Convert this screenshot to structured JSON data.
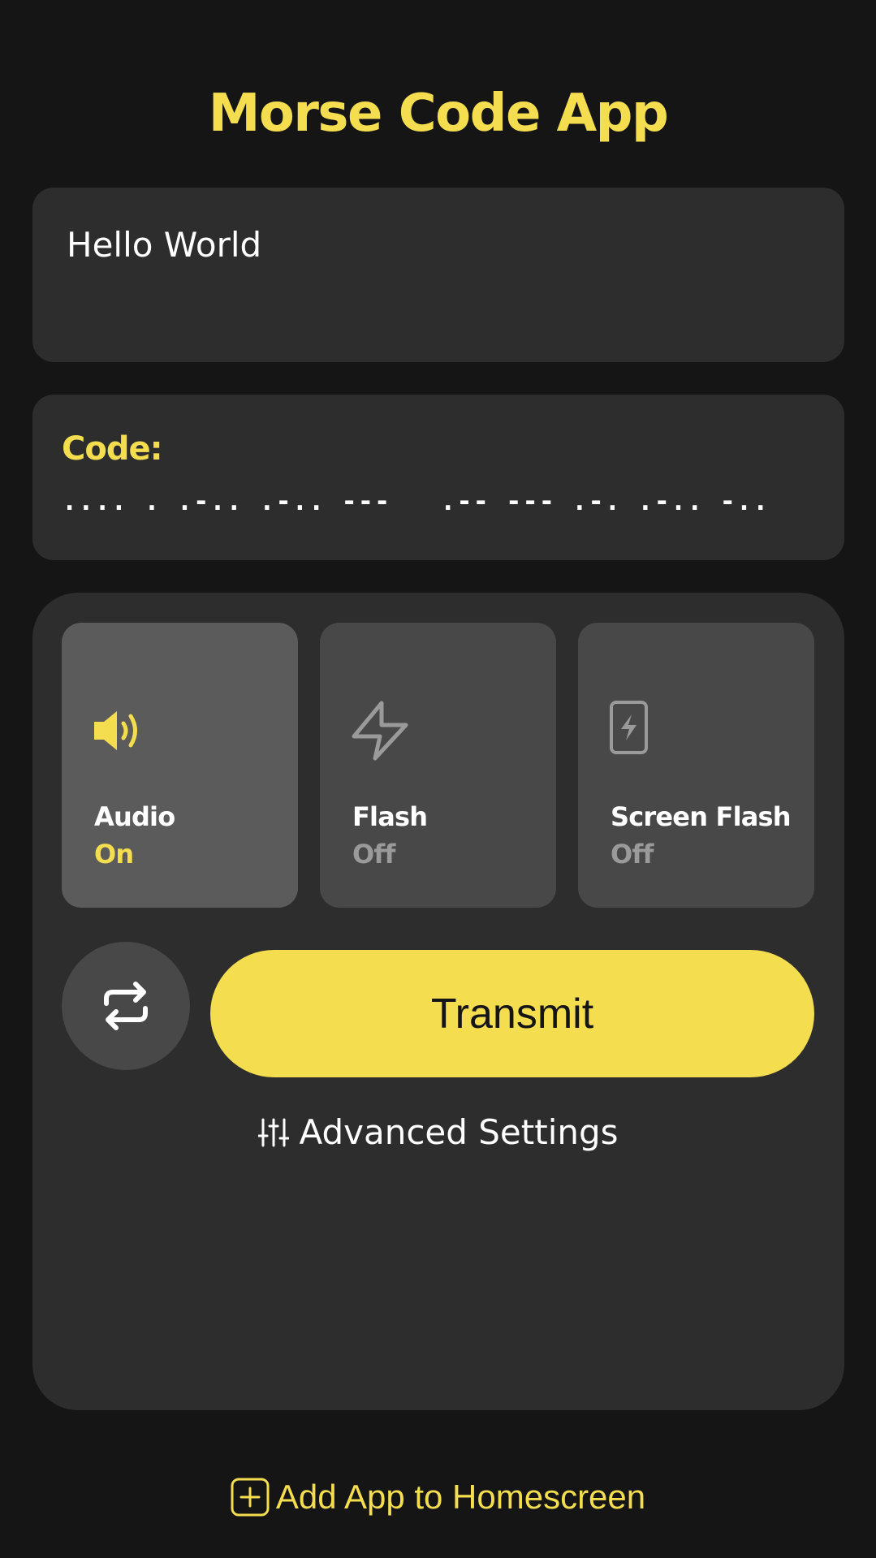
{
  "app": {
    "title": "Morse Code App"
  },
  "input": {
    "value": "Hello World"
  },
  "code": {
    "label": "Code:",
    "value": ".... . .-.. .-.. ---   .-- --- .-. .-.. -.."
  },
  "modes": [
    {
      "label": "Audio",
      "state": "On",
      "icon": "speaker-icon",
      "active": true
    },
    {
      "label": "Flash",
      "state": "Off",
      "icon": "lightning-icon",
      "active": false
    },
    {
      "label": "Screen Flash",
      "state": "Off",
      "icon": "phone-flash-icon",
      "active": false
    }
  ],
  "actions": {
    "repeat_icon": "repeat-icon",
    "transmit_label": "Transmit",
    "advanced_label": "Advanced Settings",
    "advanced_icon": "sliders-icon"
  },
  "footer": {
    "add_label": "Add App to Homescreen",
    "add_icon": "plus-square-icon"
  },
  "colors": {
    "background": "#151515",
    "card": "#2d2d2d",
    "accent": "#f4dd4e",
    "tile": "#484848",
    "tile_active": "#5b5b5b",
    "muted": "#9a9a9a"
  }
}
